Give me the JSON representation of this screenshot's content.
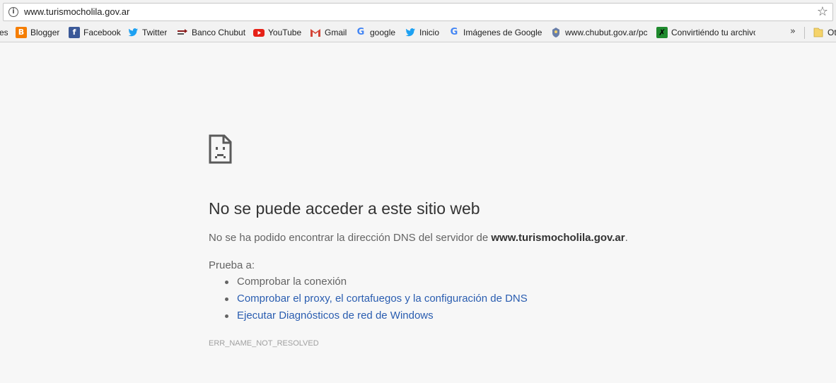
{
  "omnibox": {
    "url": "www.turismocholila.gov.ar",
    "info_icon_glyph": "i",
    "star_icon": "star-icon"
  },
  "bookmarks": [
    {
      "label": "es",
      "icon": "none"
    },
    {
      "label": "Blogger",
      "icon": "blogger-icon",
      "color": "#f57d00"
    },
    {
      "label": "Facebook",
      "icon": "facebook-icon",
      "color": "#3b5998"
    },
    {
      "label": "Twitter",
      "icon": "twitter-icon",
      "color": "#1da1f2"
    },
    {
      "label": "Banco Chubut",
      "icon": "banco-chubut-icon",
      "color": "#8b1a1a"
    },
    {
      "label": "YouTube",
      "icon": "youtube-icon",
      "color": "#e62117"
    },
    {
      "label": "Gmail",
      "icon": "gmail-icon",
      "color": "#d44638"
    },
    {
      "label": "google",
      "icon": "google-icon",
      "color": "#4285f4"
    },
    {
      "label": "Inicio",
      "icon": "twitter-icon",
      "color": "#1da1f2"
    },
    {
      "label": "Imágenes de Google",
      "icon": "google-icon",
      "color": "#4285f4"
    },
    {
      "label": "www.chubut.gov.ar/pc",
      "icon": "chubut-icon",
      "color": "#6a7fa8"
    },
    {
      "label": "Convirtiéndo tu archivo",
      "icon": "convert-icon",
      "color": "#1f8a2e"
    },
    {
      "label": "Ot",
      "icon": "folder-icon",
      "color": "#f5d36a"
    }
  ],
  "more_bookmarks_glyph": "»",
  "error": {
    "title": "No se puede acceder a este sitio web",
    "message_prefix": "No se ha podido encontrar la dirección DNS del servidor de ",
    "message_host": "www.turismocholila.gov.ar",
    "message_suffix": ".",
    "try_label": "Prueba a:",
    "suggestions": [
      "Comprobar la conexión",
      "Comprobar el proxy, el cortafuegos y la configuración de DNS",
      "Ejecutar Diagnósticos de red de Windows"
    ],
    "code": "ERR_NAME_NOT_RESOLVED"
  }
}
